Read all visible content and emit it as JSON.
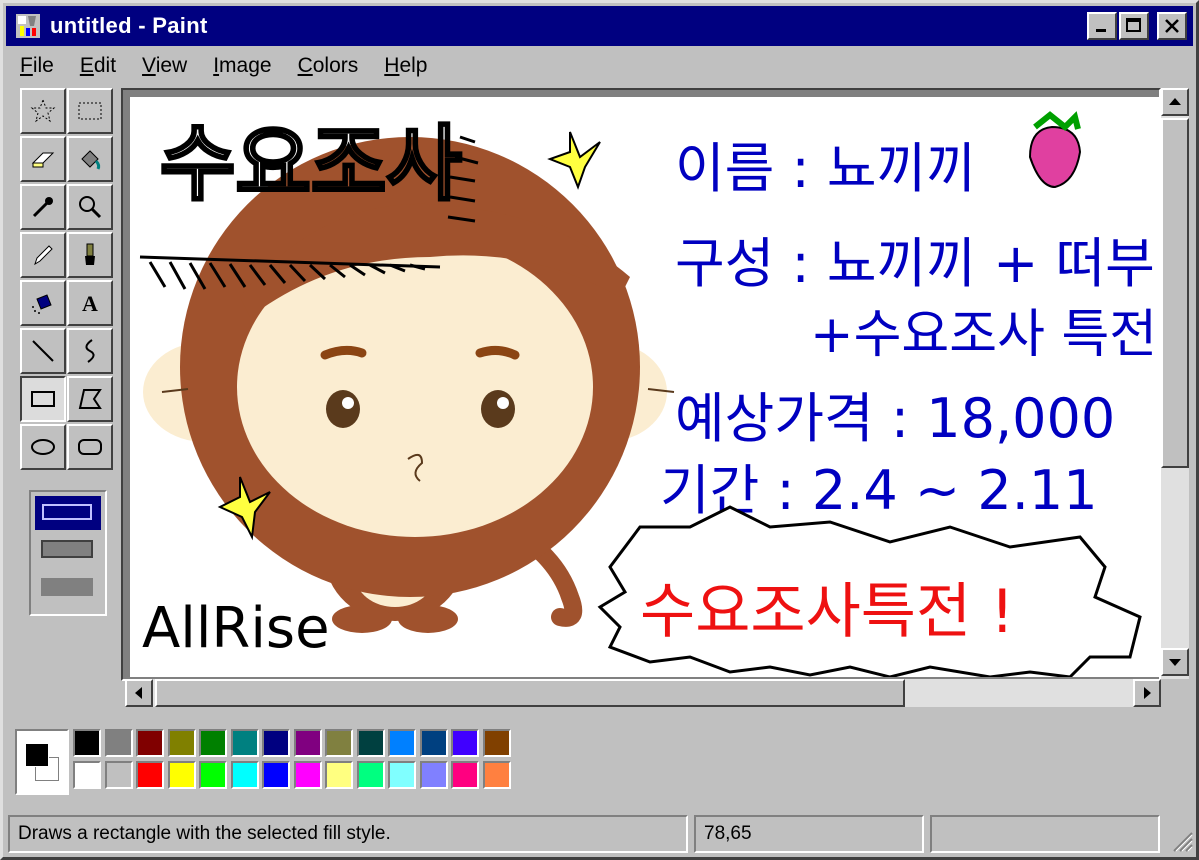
{
  "window": {
    "title": "untitled - Paint"
  },
  "menu": [
    "File",
    "Edit",
    "View",
    "Image",
    "Colors",
    "Help"
  ],
  "tools": [
    {
      "name": "free-form-select",
      "glyph": "✩"
    },
    {
      "name": "select",
      "glyph": "⬚"
    },
    {
      "name": "eraser",
      "glyph": "▱"
    },
    {
      "name": "fill-with-color",
      "glyph": "⛾"
    },
    {
      "name": "pick-color",
      "glyph": "⁄"
    },
    {
      "name": "magnifier",
      "glyph": "🔍"
    },
    {
      "name": "pencil",
      "glyph": "✎"
    },
    {
      "name": "brush",
      "glyph": "🖌"
    },
    {
      "name": "airbrush",
      "glyph": "✈"
    },
    {
      "name": "text",
      "glyph": "A"
    },
    {
      "name": "line",
      "glyph": "╲"
    },
    {
      "name": "curve",
      "glyph": "∫"
    },
    {
      "name": "rectangle",
      "glyph": "▭"
    },
    {
      "name": "polygon",
      "glyph": "⏢"
    },
    {
      "name": "ellipse",
      "glyph": "⬭"
    },
    {
      "name": "rounded-rectangle",
      "glyph": "▢"
    }
  ],
  "selected_tool": "rectangle",
  "canvas_text": {
    "title": "수요조사",
    "name_line": "이름 : 뇨끼끼",
    "config_line1": "구성 : 뇨끼끼 + 떠부",
    "config_line2": "+수요조사 특전",
    "price_line": "예상가격 : 18,000",
    "period_line": "기간 : 2.4 ~ 2.11",
    "bonus": "수요조사특전 !",
    "signature": "AllRise"
  },
  "palette": {
    "foreground": "#000000",
    "background": "#ffffff",
    "top_row": [
      "#000000",
      "#808080",
      "#800000",
      "#808000",
      "#008000",
      "#008080",
      "#000080",
      "#800080",
      "#808040",
      "#004040",
      "#0080ff",
      "#004080",
      "#4000ff",
      "#804000"
    ],
    "bottom_row": [
      "#ffffff",
      "#c0c0c0",
      "#ff0000",
      "#ffff00",
      "#00ff00",
      "#00ffff",
      "#0000ff",
      "#ff00ff",
      "#ffff80",
      "#00ff80",
      "#80ffff",
      "#8080ff",
      "#ff0080",
      "#ff8040"
    ]
  },
  "status": {
    "hint": "Draws a rectangle with the selected fill style.",
    "coords": "78,65",
    "size": ""
  }
}
